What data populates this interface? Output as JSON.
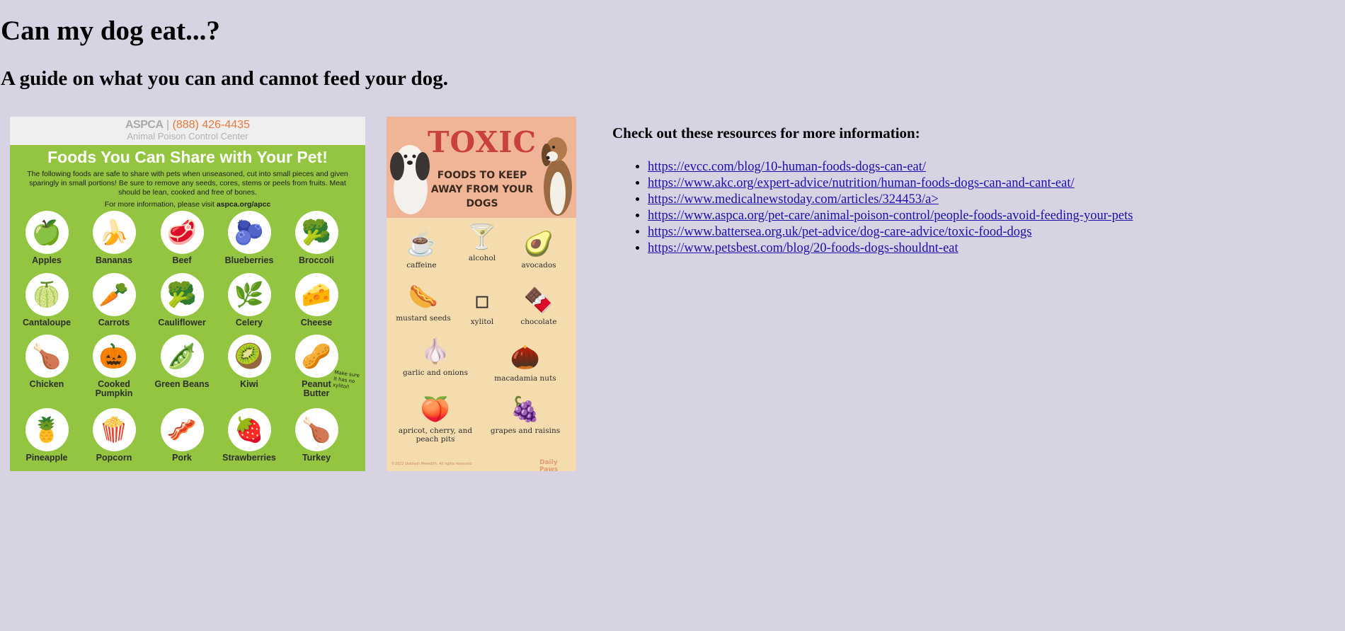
{
  "page": {
    "title": "Can my dog eat...?",
    "subtitle": "A guide on what you can and cannot feed your dog."
  },
  "safe_poster": {
    "brand": "ASPCA",
    "phone": "(888) 426-4435",
    "brand_sub": "Animal Poison Control Center",
    "title": "Foods You Can Share with Your Pet!",
    "note": "The following foods are safe to share with pets when unseasoned, cut into small pieces and given sparingly in small portions! Be sure to remove any seeds, cores, stems or peels from fruits. Meat should be lean, cooked and free of bones.",
    "more_prefix": "For more information, please visit ",
    "more_link": "aspca.org/apcc",
    "side_note": "Make sure it has no xylitol!",
    "items": [
      {
        "label": "Apples",
        "icon": "🍏"
      },
      {
        "label": "Bananas",
        "icon": "🍌"
      },
      {
        "label": "Beef",
        "icon": "🥩"
      },
      {
        "label": "Blueberries",
        "icon": "🫐"
      },
      {
        "label": "Broccoli",
        "icon": "🥦"
      },
      {
        "label": "Cantaloupe",
        "icon": "🍈"
      },
      {
        "label": "Carrots",
        "icon": "🥕"
      },
      {
        "label": "Cauliflower",
        "icon": "🥦"
      },
      {
        "label": "Celery",
        "icon": "🌿"
      },
      {
        "label": "Cheese",
        "icon": "🧀"
      },
      {
        "label": "Chicken",
        "icon": "🍗"
      },
      {
        "label": "Cooked Pumpkin",
        "icon": "🎃"
      },
      {
        "label": "Green Beans",
        "icon": "🫛"
      },
      {
        "label": "Kiwi",
        "icon": "🥝"
      },
      {
        "label": "Peanut Butter",
        "icon": "🥜"
      },
      {
        "label": "Pineapple",
        "icon": "🍍"
      },
      {
        "label": "Popcorn",
        "icon": "🍿"
      },
      {
        "label": "Pork",
        "icon": "🥓"
      },
      {
        "label": "Strawberries",
        "icon": "🍓"
      },
      {
        "label": "Turkey",
        "icon": "🍗"
      }
    ]
  },
  "toxic_poster": {
    "title": "TOXIC",
    "subtitle": "FOODS TO KEEP AWAY FROM YOUR DOGS",
    "footer_left": "©2022 Dotdash Meredith. All rights reserved.",
    "footer_right": "Daily Paws",
    "items": [
      {
        "label": "caffeine",
        "icon": "☕"
      },
      {
        "label": "alcohol",
        "icon": "🍸"
      },
      {
        "label": "avocados",
        "icon": "🥑"
      },
      {
        "label": "mustard seeds",
        "icon": "🌭"
      },
      {
        "label": "xylitol",
        "icon": "▫"
      },
      {
        "label": "chocolate",
        "icon": "🍫"
      },
      {
        "label": "garlic and onions",
        "icon": "🧄"
      },
      {
        "label": "macadamia nuts",
        "icon": "🌰"
      },
      {
        "label": "apricot, cherry, and peach pits",
        "icon": "🍑"
      },
      {
        "label": "grapes and raisins",
        "icon": "🍇"
      }
    ]
  },
  "resources": {
    "heading": "Check out these resources for more information:",
    "links": [
      "https://evcc.com/blog/10-human-foods-dogs-can-eat/",
      "https://www.akc.org/expert-advice/nutrition/human-foods-dogs-can-and-cant-eat/",
      "https://www.medicalnewstoday.com/articles/324453/a>",
      "https://www.aspca.org/pet-care/animal-poison-control/people-foods-avoid-feeding-your-pets",
      "https://www.battersea.org.uk/pet-advice/dog-care-advice/toxic-food-dogs",
      "https://www.petsbest.com/blog/20-foods-dogs-shouldnt-eat"
    ]
  }
}
